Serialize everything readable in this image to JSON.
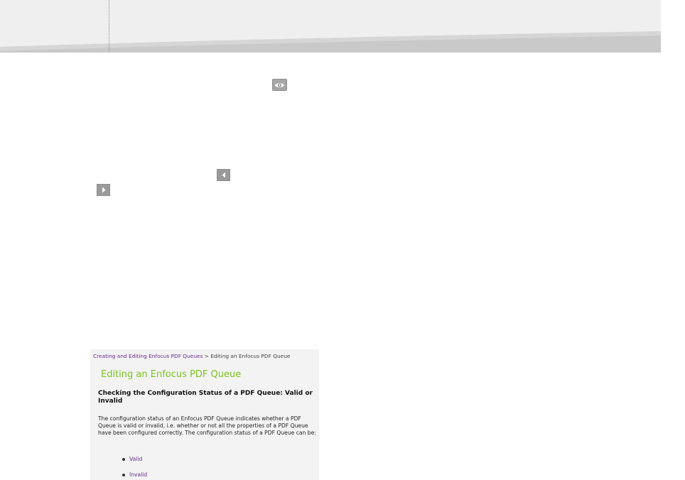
{
  "icons": {
    "preview": "eye-icon",
    "previous": "triangle-left-icon",
    "next": "triangle-right-icon"
  },
  "colors": {
    "header_bg": "#efefef",
    "header_swoosh": "#c9c9c9",
    "panel_bg": "#f3f3f3",
    "title_green": "#7cc21f",
    "link_purple": "#6a2d8f",
    "button_gray": "#9a9a9a"
  },
  "panel": {
    "breadcrumb": {
      "link": "Creating and Editing Enfocus PDF Queues",
      "separator": " > ",
      "current": "Editing an Enfocus PDF Queue"
    },
    "title": "Editing an Enfocus PDF Queue",
    "subtitle": "Checking the Configuration Status of a PDF Queue: Valid or Invalid",
    "body": "The configuration status of an Enfocus PDF Queue indicates whether a PDF Queue is valid or invalid, i.e. whether or not all the properties of a PDF Queue have been configured correctly. The configuration status of a PDF Queue can be:",
    "list": [
      {
        "label": "Valid"
      },
      {
        "label": "Invalid"
      }
    ]
  }
}
